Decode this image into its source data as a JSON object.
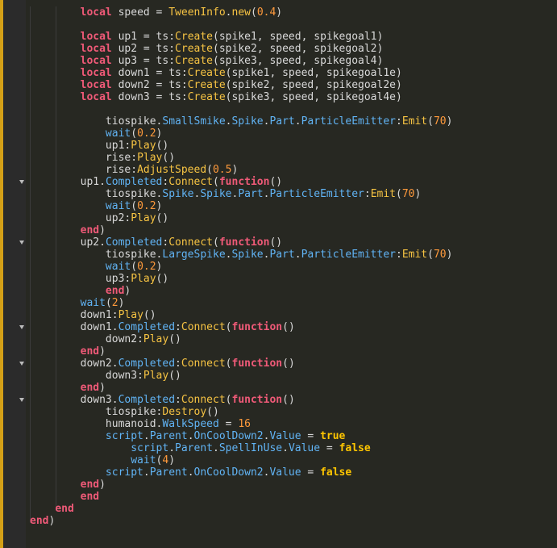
{
  "editor": {
    "colors": {
      "background": "#272822",
      "gutter": "#2b2b2b",
      "keyword": "#f05a78",
      "function": "#f6c343",
      "property": "#61b4f5",
      "number": "#ff9a3c",
      "boolean": "#ffc600",
      "text": "#d9d9d9"
    },
    "fold_icon": "chevron-down-icon",
    "lines": [
      {
        "indent": 8,
        "fold": false,
        "tokens": [
          [
            "k",
            "local"
          ],
          [
            "id",
            " speed = "
          ],
          [
            "fn",
            "TweenInfo"
          ],
          [
            "pun",
            "."
          ],
          [
            "fn",
            "new"
          ],
          [
            "pun",
            "("
          ],
          [
            "num",
            "0.4"
          ],
          [
            "pun",
            ")"
          ]
        ]
      },
      {
        "indent": 0,
        "fold": false,
        "tokens": []
      },
      {
        "indent": 8,
        "fold": false,
        "tokens": [
          [
            "k",
            "local"
          ],
          [
            "id",
            " up1 = ts:"
          ],
          [
            "fn",
            "Create"
          ],
          [
            "id",
            "(spike1, speed, spikegoal1)"
          ]
        ]
      },
      {
        "indent": 8,
        "fold": false,
        "tokens": [
          [
            "k",
            "local"
          ],
          [
            "id",
            " up2 = ts:"
          ],
          [
            "fn",
            "Create"
          ],
          [
            "id",
            "(spike2, speed, spikegoal2)"
          ]
        ]
      },
      {
        "indent": 8,
        "fold": false,
        "tokens": [
          [
            "k",
            "local"
          ],
          [
            "id",
            " up3 = ts:"
          ],
          [
            "fn",
            "Create"
          ],
          [
            "id",
            "(spike3, speed, spikegoal4)"
          ]
        ]
      },
      {
        "indent": 8,
        "fold": false,
        "tokens": [
          [
            "k",
            "local"
          ],
          [
            "id",
            " down1 = ts:"
          ],
          [
            "fn",
            "Create"
          ],
          [
            "id",
            "(spike1, speed, spikegoal1e)"
          ]
        ]
      },
      {
        "indent": 8,
        "fold": false,
        "tokens": [
          [
            "k",
            "local"
          ],
          [
            "id",
            " down2 = ts:"
          ],
          [
            "fn",
            "Create"
          ],
          [
            "id",
            "(spike2, speed, spikegoal2e)"
          ]
        ]
      },
      {
        "indent": 8,
        "fold": false,
        "tokens": [
          [
            "k",
            "local"
          ],
          [
            "id",
            " down3 = ts:"
          ],
          [
            "fn",
            "Create"
          ],
          [
            "id",
            "(spike3, speed, spikegoal4e)"
          ]
        ]
      },
      {
        "indent": 0,
        "fold": false,
        "tokens": []
      },
      {
        "indent": 12,
        "fold": false,
        "tokens": [
          [
            "id",
            "tiospike."
          ],
          [
            "prop",
            "SmallSmike"
          ],
          [
            "pun",
            "."
          ],
          [
            "prop",
            "Spike"
          ],
          [
            "pun",
            "."
          ],
          [
            "prop",
            "Part"
          ],
          [
            "pun",
            "."
          ],
          [
            "prop",
            "ParticleEmitter"
          ],
          [
            "pun",
            ":"
          ],
          [
            "fn",
            "Emit"
          ],
          [
            "pun",
            "("
          ],
          [
            "num",
            "70"
          ],
          [
            "pun",
            ")"
          ]
        ]
      },
      {
        "indent": 12,
        "fold": false,
        "tokens": [
          [
            "prop",
            "wait"
          ],
          [
            "pun",
            "("
          ],
          [
            "num",
            "0.2"
          ],
          [
            "pun",
            ")"
          ]
        ]
      },
      {
        "indent": 12,
        "fold": false,
        "tokens": [
          [
            "id",
            "up1:"
          ],
          [
            "fn",
            "Play"
          ],
          [
            "pun",
            "()"
          ]
        ]
      },
      {
        "indent": 12,
        "fold": false,
        "tokens": [
          [
            "id",
            "rise:"
          ],
          [
            "fn",
            "Play"
          ],
          [
            "pun",
            "()"
          ]
        ]
      },
      {
        "indent": 12,
        "fold": false,
        "tokens": [
          [
            "id",
            "rise:"
          ],
          [
            "fn",
            "AdjustSpeed"
          ],
          [
            "pun",
            "("
          ],
          [
            "num",
            "0.5"
          ],
          [
            "pun",
            ")"
          ]
        ]
      },
      {
        "indent": 8,
        "fold": true,
        "tokens": [
          [
            "id",
            "up1."
          ],
          [
            "prop",
            "Completed"
          ],
          [
            "pun",
            ":"
          ],
          [
            "fn",
            "Connect"
          ],
          [
            "pun",
            "("
          ],
          [
            "k",
            "function"
          ],
          [
            "pun",
            "()"
          ]
        ]
      },
      {
        "indent": 12,
        "fold": false,
        "tokens": [
          [
            "id",
            "tiospike."
          ],
          [
            "prop",
            "Spike"
          ],
          [
            "pun",
            "."
          ],
          [
            "prop",
            "Spike"
          ],
          [
            "pun",
            "."
          ],
          [
            "prop",
            "Part"
          ],
          [
            "pun",
            "."
          ],
          [
            "prop",
            "ParticleEmitter"
          ],
          [
            "pun",
            ":"
          ],
          [
            "fn",
            "Emit"
          ],
          [
            "pun",
            "("
          ],
          [
            "num",
            "70"
          ],
          [
            "pun",
            ")"
          ]
        ]
      },
      {
        "indent": 12,
        "fold": false,
        "tokens": [
          [
            "prop",
            "wait"
          ],
          [
            "pun",
            "("
          ],
          [
            "num",
            "0.2"
          ],
          [
            "pun",
            ")"
          ]
        ]
      },
      {
        "indent": 12,
        "fold": false,
        "tokens": [
          [
            "id",
            "up2:"
          ],
          [
            "fn",
            "Play"
          ],
          [
            "pun",
            "()"
          ]
        ]
      },
      {
        "indent": 8,
        "fold": false,
        "tokens": [
          [
            "k",
            "end"
          ],
          [
            "pun",
            ")"
          ]
        ]
      },
      {
        "indent": 8,
        "fold": true,
        "tokens": [
          [
            "id",
            "up2."
          ],
          [
            "prop",
            "Completed"
          ],
          [
            "pun",
            ":"
          ],
          [
            "fn",
            "Connect"
          ],
          [
            "pun",
            "("
          ],
          [
            "k",
            "function"
          ],
          [
            "pun",
            "()"
          ]
        ]
      },
      {
        "indent": 12,
        "fold": false,
        "tokens": [
          [
            "id",
            "tiospike."
          ],
          [
            "prop",
            "LargeSpike"
          ],
          [
            "pun",
            "."
          ],
          [
            "prop",
            "Spike"
          ],
          [
            "pun",
            "."
          ],
          [
            "prop",
            "Part"
          ],
          [
            "pun",
            "."
          ],
          [
            "prop",
            "ParticleEmitter"
          ],
          [
            "pun",
            ":"
          ],
          [
            "fn",
            "Emit"
          ],
          [
            "pun",
            "("
          ],
          [
            "num",
            "70"
          ],
          [
            "pun",
            ")"
          ]
        ]
      },
      {
        "indent": 12,
        "fold": false,
        "tokens": [
          [
            "prop",
            "wait"
          ],
          [
            "pun",
            "("
          ],
          [
            "num",
            "0.2"
          ],
          [
            "pun",
            ")"
          ]
        ]
      },
      {
        "indent": 12,
        "fold": false,
        "tokens": [
          [
            "id",
            "up3:"
          ],
          [
            "fn",
            "Play"
          ],
          [
            "pun",
            "()"
          ]
        ]
      },
      {
        "indent": 12,
        "fold": false,
        "tokens": [
          [
            "k",
            "end"
          ],
          [
            "pun",
            ")"
          ]
        ]
      },
      {
        "indent": 8,
        "fold": false,
        "tokens": [
          [
            "prop",
            "wait"
          ],
          [
            "pun",
            "("
          ],
          [
            "num",
            "2"
          ],
          [
            "pun",
            ")"
          ]
        ]
      },
      {
        "indent": 8,
        "fold": false,
        "tokens": [
          [
            "id",
            "down1:"
          ],
          [
            "fn",
            "Play"
          ],
          [
            "pun",
            "()"
          ]
        ]
      },
      {
        "indent": 8,
        "fold": true,
        "tokens": [
          [
            "id",
            "down1."
          ],
          [
            "prop",
            "Completed"
          ],
          [
            "pun",
            ":"
          ],
          [
            "fn",
            "Connect"
          ],
          [
            "pun",
            "("
          ],
          [
            "k",
            "function"
          ],
          [
            "pun",
            "()"
          ]
        ]
      },
      {
        "indent": 12,
        "fold": false,
        "tokens": [
          [
            "id",
            "down2:"
          ],
          [
            "fn",
            "Play"
          ],
          [
            "pun",
            "()"
          ]
        ]
      },
      {
        "indent": 8,
        "fold": false,
        "tokens": [
          [
            "k",
            "end"
          ],
          [
            "pun",
            ")"
          ]
        ]
      },
      {
        "indent": 8,
        "fold": true,
        "tokens": [
          [
            "id",
            "down2."
          ],
          [
            "prop",
            "Completed"
          ],
          [
            "pun",
            ":"
          ],
          [
            "fn",
            "Connect"
          ],
          [
            "pun",
            "("
          ],
          [
            "k",
            "function"
          ],
          [
            "pun",
            "()"
          ]
        ]
      },
      {
        "indent": 12,
        "fold": false,
        "tokens": [
          [
            "id",
            "down3:"
          ],
          [
            "fn",
            "Play"
          ],
          [
            "pun",
            "()"
          ]
        ]
      },
      {
        "indent": 8,
        "fold": false,
        "tokens": [
          [
            "k",
            "end"
          ],
          [
            "pun",
            ")"
          ]
        ]
      },
      {
        "indent": 8,
        "fold": true,
        "tokens": [
          [
            "id",
            "down3."
          ],
          [
            "prop",
            "Completed"
          ],
          [
            "pun",
            ":"
          ],
          [
            "fn",
            "Connect"
          ],
          [
            "pun",
            "("
          ],
          [
            "k",
            "function"
          ],
          [
            "pun",
            "()"
          ]
        ]
      },
      {
        "indent": 12,
        "fold": false,
        "tokens": [
          [
            "id",
            "tiospike:"
          ],
          [
            "fn",
            "Destroy"
          ],
          [
            "pun",
            "()"
          ]
        ]
      },
      {
        "indent": 12,
        "fold": false,
        "tokens": [
          [
            "id",
            "humanoid."
          ],
          [
            "prop",
            "WalkSpeed"
          ],
          [
            "id",
            " = "
          ],
          [
            "num",
            "16"
          ]
        ]
      },
      {
        "indent": 12,
        "fold": false,
        "tokens": [
          [
            "prop",
            "script"
          ],
          [
            "pun",
            "."
          ],
          [
            "prop",
            "Parent"
          ],
          [
            "pun",
            "."
          ],
          [
            "prop",
            "OnCoolDown2"
          ],
          [
            "pun",
            "."
          ],
          [
            "prop",
            "Value"
          ],
          [
            "id",
            " = "
          ],
          [
            "bool",
            "true"
          ]
        ]
      },
      {
        "indent": 16,
        "fold": false,
        "tokens": [
          [
            "prop",
            "script"
          ],
          [
            "pun",
            "."
          ],
          [
            "prop",
            "Parent"
          ],
          [
            "pun",
            "."
          ],
          [
            "prop",
            "SpellInUse"
          ],
          [
            "pun",
            "."
          ],
          [
            "prop",
            "Value"
          ],
          [
            "id",
            " = "
          ],
          [
            "bool",
            "false"
          ]
        ]
      },
      {
        "indent": 16,
        "fold": false,
        "tokens": [
          [
            "prop",
            "wait"
          ],
          [
            "pun",
            "("
          ],
          [
            "num",
            "4"
          ],
          [
            "pun",
            ")"
          ]
        ]
      },
      {
        "indent": 12,
        "fold": false,
        "tokens": [
          [
            "prop",
            "script"
          ],
          [
            "pun",
            "."
          ],
          [
            "prop",
            "Parent"
          ],
          [
            "pun",
            "."
          ],
          [
            "prop",
            "OnCoolDown2"
          ],
          [
            "pun",
            "."
          ],
          [
            "prop",
            "Value"
          ],
          [
            "id",
            " = "
          ],
          [
            "bool",
            "false"
          ]
        ]
      },
      {
        "indent": 8,
        "fold": false,
        "tokens": [
          [
            "k",
            "end"
          ],
          [
            "pun",
            ")"
          ]
        ]
      },
      {
        "indent": 8,
        "fold": false,
        "tokens": [
          [
            "k",
            "end"
          ]
        ]
      },
      {
        "indent": 4,
        "fold": false,
        "tokens": [
          [
            "k",
            "end"
          ]
        ]
      },
      {
        "indent": 0,
        "fold": false,
        "tokens": [
          [
            "k",
            "end"
          ],
          [
            "pun",
            ")"
          ]
        ]
      }
    ]
  }
}
